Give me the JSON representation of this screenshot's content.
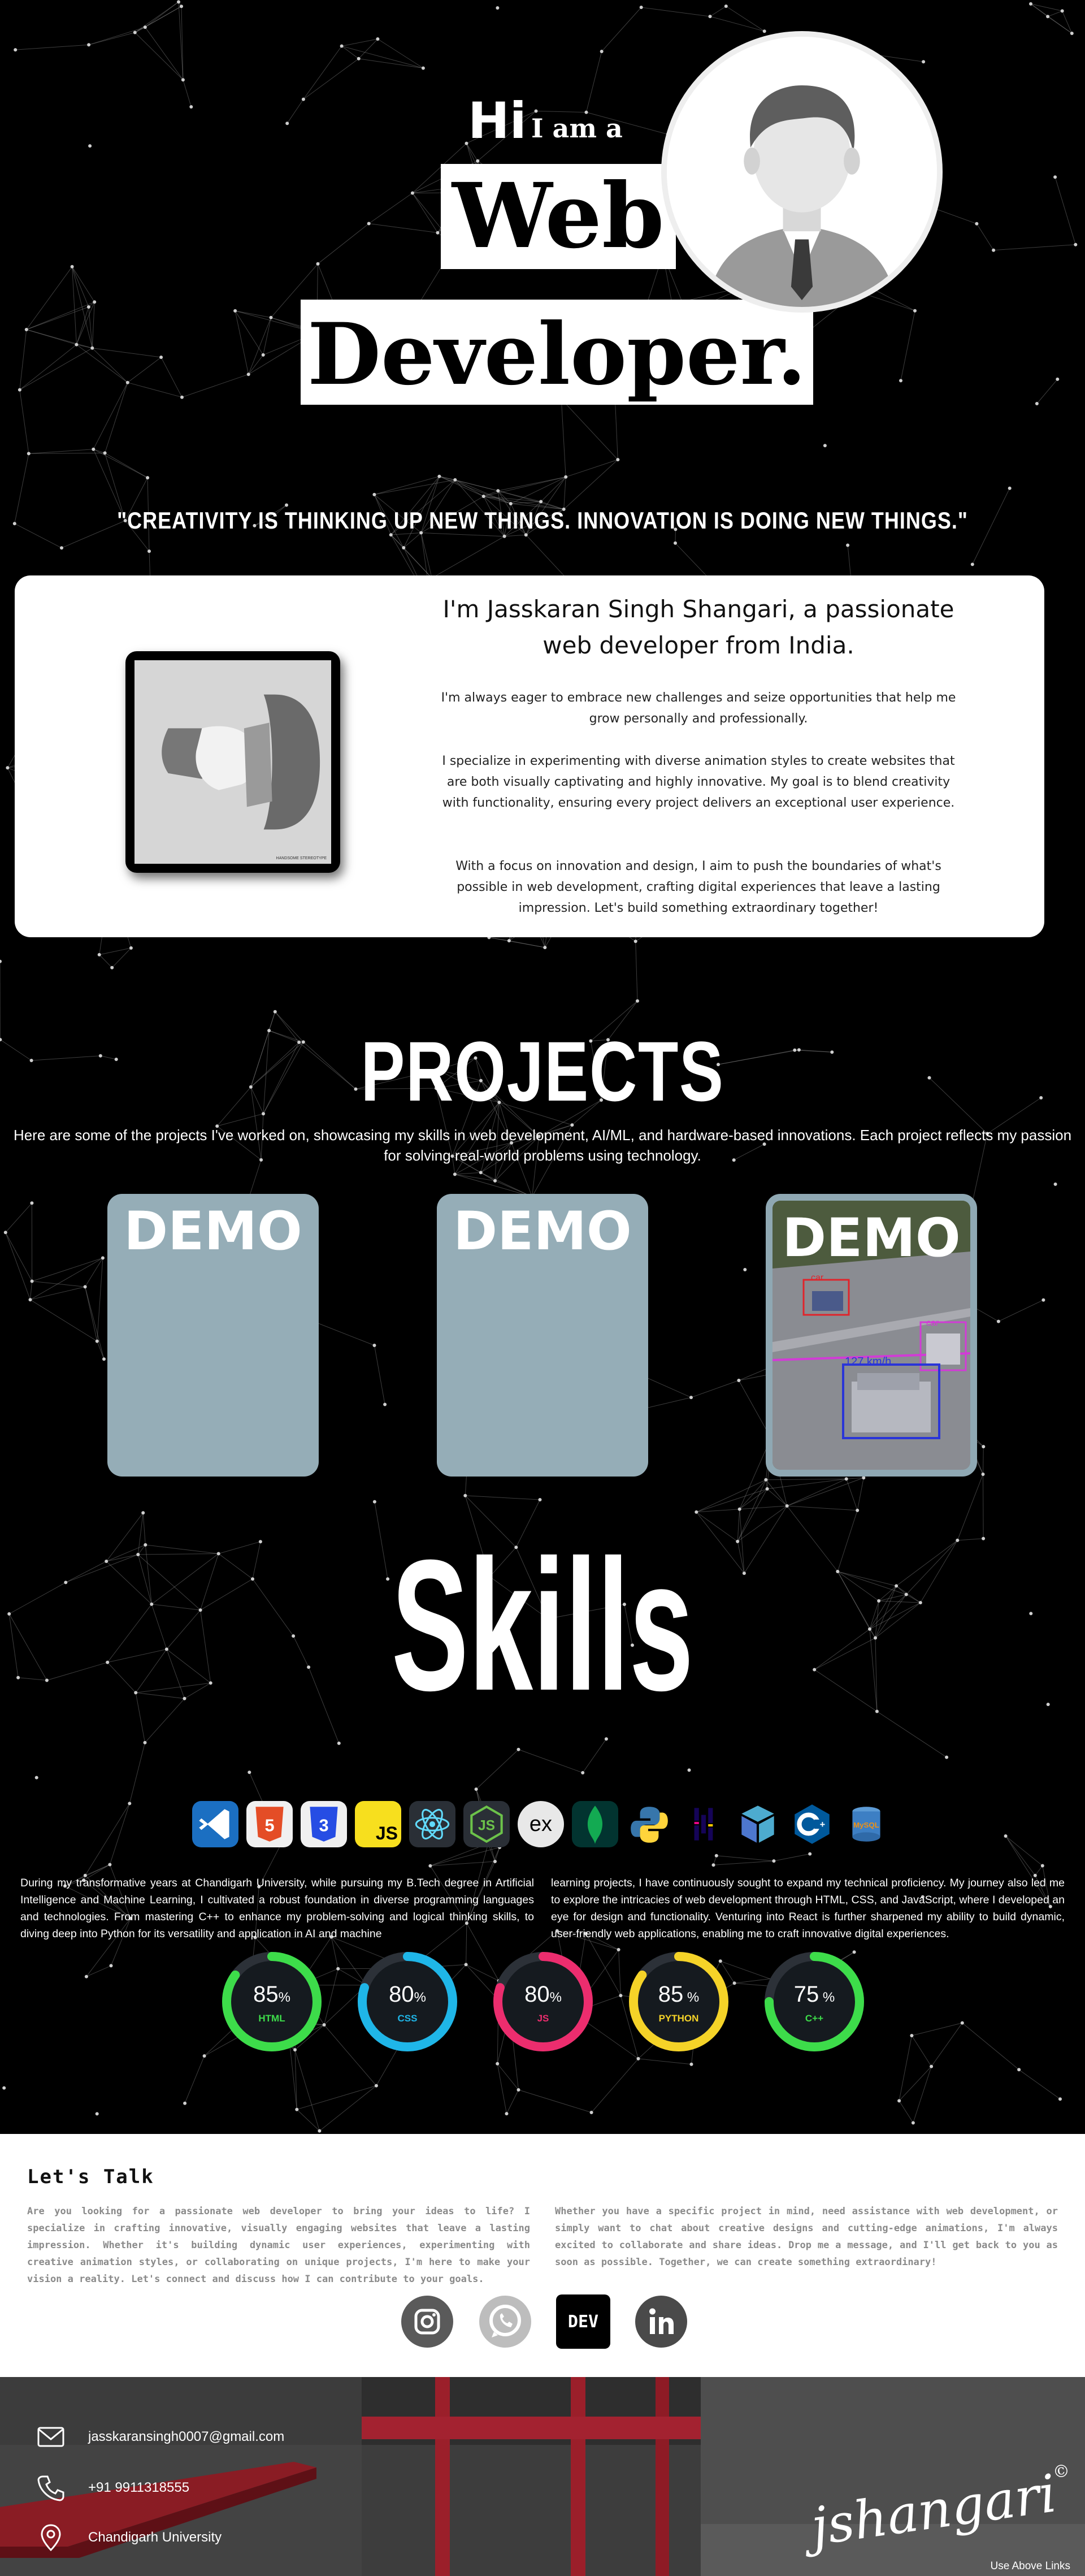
{
  "hero": {
    "hi": "Hi",
    "i_am_a": "I am a",
    "word1": "Web",
    "word2": "Developer.",
    "quote": "\"CREATIVITY IS THINKING UP NEW THINGS. INNOVATION IS DOING NEW THINGS.\""
  },
  "about": {
    "title": "I'm Jasskaran Singh Shangari, a passionate web developer from India.",
    "photo_caption": "HANDSOME STEREOTYPE",
    "paragraphs": [
      "I'm always eager to embrace new challenges and seize opportunities that help me grow personally and professionally.",
      "I specialize in experimenting with diverse animation styles to create websites that are both visually captivating and highly innovative. My goal is to blend creativity with functionality, ensuring every project delivers an exceptional user experience.",
      "With a focus on innovation and design, I aim to push the boundaries of what's possible in web development, crafting digital experiences that leave a lasting impression. Let's build something extraordinary together!"
    ]
  },
  "projects": {
    "title": "PROJECTS",
    "description": "Here are some of the projects I've worked on, showcasing my skills in web development, AI/ML, and hardware-based innovations. Each project reflects my passion for solving real-world problems using technology.",
    "cards": [
      {
        "label": "DEMO"
      },
      {
        "label": "DEMO"
      },
      {
        "label": "DEMO",
        "detections": [
          "car",
          "car",
          "127 km/h"
        ]
      }
    ]
  },
  "skills": {
    "title": "Skills",
    "icons": [
      "vscode-icon",
      "html5-icon",
      "css3-icon",
      "javascript-icon",
      "react-icon",
      "nodejs-icon",
      "express-icon",
      "mongodb-icon",
      "python-icon",
      "pandas-icon",
      "numpy-icon",
      "cplusplus-icon",
      "mysql-icon"
    ],
    "icon_texts": {
      "js": "JS",
      "express": "ex",
      "mysql": "MySQL"
    },
    "text_left": "During my transformative years at Chandigarh University, while pursuing my B.Tech degree in Artificial Intelligence and Machine Learning, I cultivated a robust foundation in diverse programming languages and technologies. From mastering C++ to enhance my problem-solving and logical thinking skills, to diving deep into Python for its versatility and application in AI and machine",
    "text_right": "learning projects, I have continuously sought to expand my technical proficiency. My journey also led me to explore the intricacies of web development through HTML, CSS, and JavaScript, where I developed an eye for design and functionality. Venturing into React is further sharpened my ability to build dynamic, user-friendly web applications, enabling me to craft innovative digital experiences.",
    "gauges": [
      {
        "value": "85",
        "unit": "%",
        "label": "HTML",
        "color": "#3ddc4a",
        "fraction": 0.85
      },
      {
        "value": "80",
        "unit": "%",
        "label": "CSS",
        "color": "#1fb6e8",
        "fraction": 0.8
      },
      {
        "value": "80",
        "unit": "%",
        "label": "JS",
        "color": "#ec2d6e",
        "fraction": 0.8
      },
      {
        "value": "85",
        "unit": " %",
        "label": "PYTHON",
        "color": "#f5d328",
        "fraction": 0.85
      },
      {
        "value": "75",
        "unit": " %",
        "label": "C++",
        "color": "#3ddc4a",
        "fraction": 0.75
      }
    ]
  },
  "contact": {
    "title": "Let's Talk",
    "text_left": "Are you looking for a passionate web developer to bring your ideas to life? I specialize in crafting innovative, visually engaging websites that leave a lasting impression. Whether it's building dynamic user experiences, experimenting with creative animation styles, or collaborating on unique projects, I'm here to make your vision a reality. Let's connect and discuss how I can contribute to your goals.",
    "text_right": "Whether you have a specific project in mind, need assistance with web development, or simply want to chat about creative designs and cutting-edge animations, I'm always excited to collaborate and share ideas. Drop me a message, and I'll get back to you as soon as possible. Together, we can create something extraordinary!",
    "socials": [
      "instagram-icon",
      "whatsapp-icon",
      "dev-icon",
      "linkedin-icon"
    ],
    "dev_label": "DEV"
  },
  "footer": {
    "email": "jasskaransingh0007@gmail.com",
    "phone": "+91 9911318555",
    "location": "Chandigarh University",
    "signature": "jshangari",
    "signature_mark": "©",
    "links_note": "Use Above Links"
  }
}
